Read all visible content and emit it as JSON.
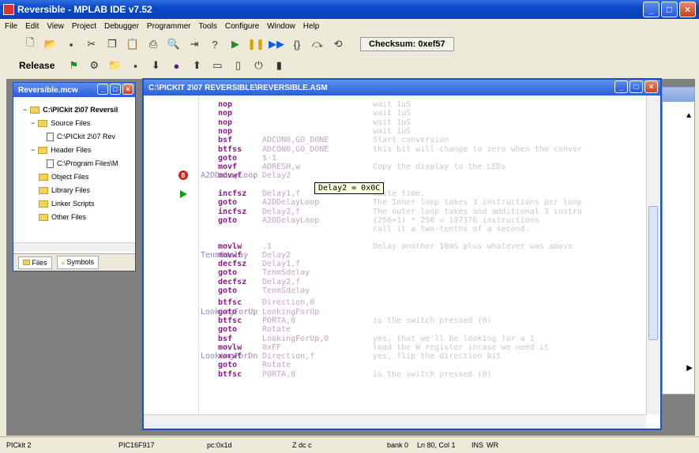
{
  "window": {
    "title": "Reversible - MPLAB IDE v7.52"
  },
  "menu": [
    "File",
    "Edit",
    "View",
    "Project",
    "Debugger",
    "Programmer",
    "Tools",
    "Configure",
    "Window",
    "Help"
  ],
  "toolbar": {
    "checksum_label": "Checksum:",
    "checksum_value": "0xef57",
    "build_config": "Release"
  },
  "project_window": {
    "title": "Reversible.mcw",
    "tree": [
      {
        "label": "C:\\PICkit 2\\07 Reversil",
        "kind": "root"
      },
      {
        "label": "Source Files",
        "kind": "folder"
      },
      {
        "label": "C:\\PICkit 2\\07 Rev",
        "kind": "file"
      },
      {
        "label": "Header Files",
        "kind": "folder"
      },
      {
        "label": "C:\\Program Files\\M",
        "kind": "file"
      },
      {
        "label": "Object Files",
        "kind": "folder"
      },
      {
        "label": "Library Files",
        "kind": "folder"
      },
      {
        "label": "Linker Scripts",
        "kind": "folder"
      },
      {
        "label": "Other Files",
        "kind": "folder"
      }
    ],
    "tabs": [
      "Files",
      "Symbols"
    ]
  },
  "editor": {
    "title": "C:\\PICKIT 2\\07 REVERSIBLE\\REVERSIBLE.ASM",
    "tooltip": "Delay2 = 0x0C",
    "lines": [
      {
        "instr": "nop",
        "operand": "",
        "comment": "wait 1uS"
      },
      {
        "instr": "nop",
        "operand": "",
        "comment": "wait 1uS"
      },
      {
        "instr": "nop",
        "operand": "",
        "comment": "wait 1uS"
      },
      {
        "instr": "nop",
        "operand": "",
        "comment": "wait 1uS"
      },
      {
        "instr": "bsf",
        "operand": "ADCON0,GO_DONE",
        "comment": "Start conversion"
      },
      {
        "instr": "btfss",
        "operand": "ADCON0,GO_DONE",
        "comment": "this bit will change to zero when the conver"
      },
      {
        "instr": "goto",
        "operand": "$-1",
        "comment": ""
      },
      {
        "instr": "movf",
        "operand": "ADRESH,w",
        "comment": "Copy the display to the LEDs"
      },
      {
        "instr": "movwf",
        "operand": "Delay2",
        "comment": ""
      },
      {
        "instr": "",
        "operand": "",
        "comment": ""
      },
      {
        "instr": "incfsz",
        "operand": "Delay1,f",
        "comment": "Waste time."
      },
      {
        "instr": "goto",
        "operand": "A2DDelayLoop",
        "comment": "The Inner loop takes 3 instructions per loop"
      },
      {
        "instr": "incfsz",
        "operand": "Delay2,f",
        "comment": "The outer loop takes and additional 3 instru"
      },
      {
        "instr": "goto",
        "operand": "A2DDelayLoop",
        "comment": "(256+1) * 256 = 197376 instructions"
      },
      {
        "instr": "",
        "operand": "",
        "comment": "call it a two-tenths of a second."
      },
      {
        "instr": "movlw",
        "operand": ".1",
        "comment": "Delay another 10mS plus whatever was above"
      },
      {
        "instr": "movwf",
        "operand": "Delay2",
        "comment": ""
      },
      {
        "instr": "decfsz",
        "operand": "Delay1,f",
        "comment": ""
      },
      {
        "instr": "goto",
        "operand": "TenmSdelay",
        "comment": ""
      },
      {
        "instr": "decfsz",
        "operand": "Delay2,f",
        "comment": ""
      },
      {
        "instr": "goto",
        "operand": "TenmSdelay",
        "comment": ""
      },
      {
        "instr": "btfsc",
        "operand": "Direction,0",
        "comment": ""
      },
      {
        "instr": "goto",
        "operand": "LookingForUp",
        "comment": ""
      },
      {
        "instr": "btfsc",
        "operand": "PORTA,0",
        "comment": "is the switch pressed (0)"
      },
      {
        "instr": "goto",
        "operand": "Rotate",
        "comment": ""
      },
      {
        "instr": "bsf",
        "operand": "LookingForUp,0",
        "comment": "yes, that we'll be looking for a 1"
      },
      {
        "instr": "movlw",
        "operand": "0xFF",
        "comment": "load the W register incase we need it"
      },
      {
        "instr": "xorwf",
        "operand": "Direction,f",
        "comment": "yes, flip the direction bit"
      },
      {
        "instr": "goto",
        "operand": "Rotate",
        "comment": ""
      },
      {
        "instr": "btfsc",
        "operand": "PORTA,0",
        "comment": "is the switch pressed (0)"
      }
    ],
    "labels": [
      "A2DDelayLoop",
      "TenmSdelay",
      "LookingForUp",
      "LookingForDn"
    ]
  },
  "second_window": {
    "title": ""
  },
  "status": {
    "tool": "PICkit 2",
    "device": "PIC16F917",
    "pc": "pc:0x1d",
    "flags": "Z dc c",
    "bank": "bank 0",
    "position": "Ln 80, Col 1",
    "ins": "INS",
    "wr": "WR"
  }
}
